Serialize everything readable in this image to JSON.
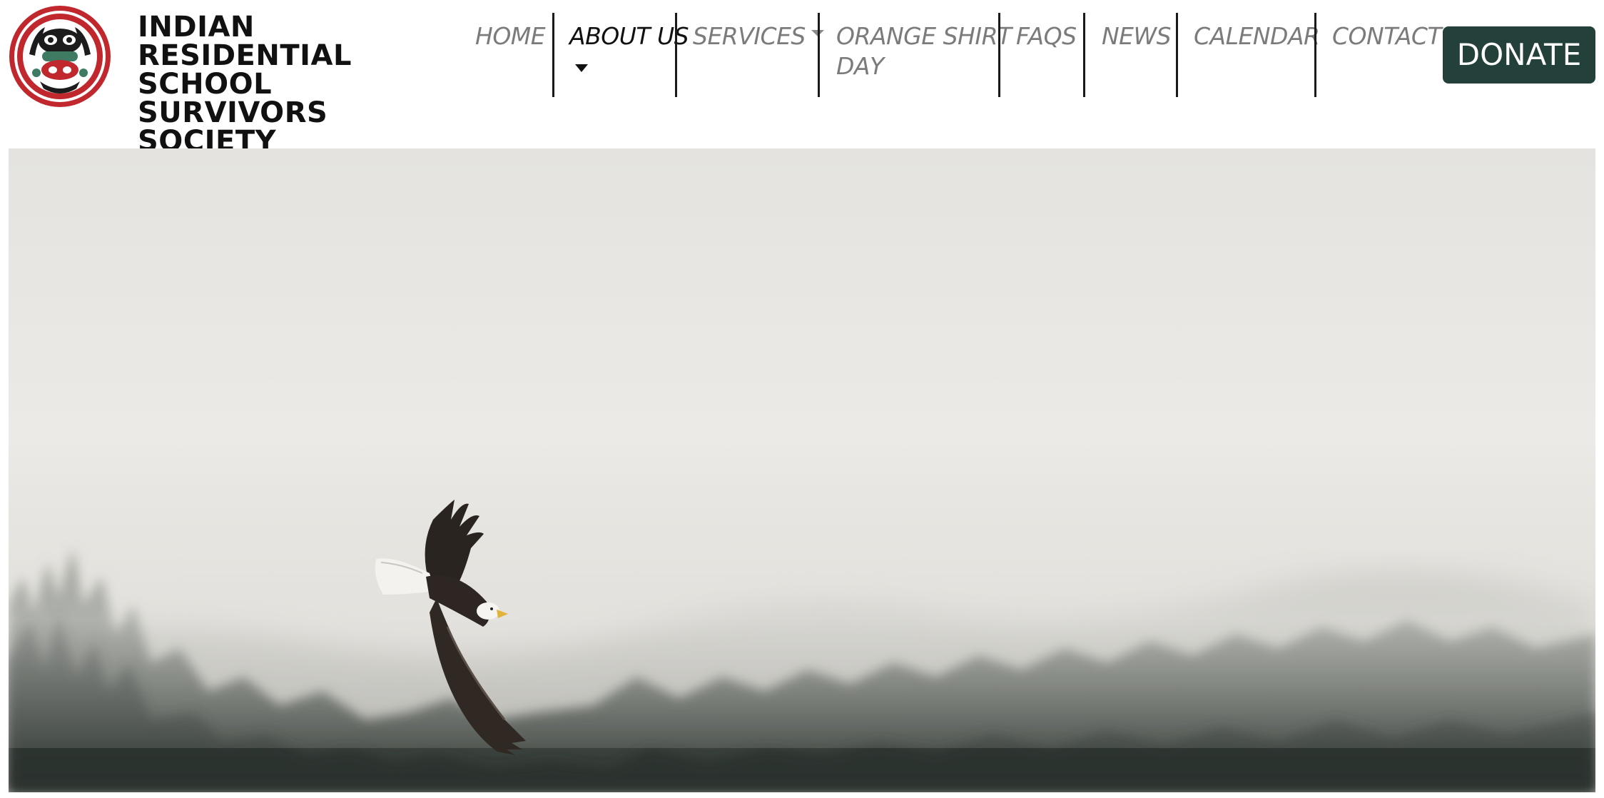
{
  "site": {
    "title_lines": [
      "INDIAN RESIDENTIAL",
      "SCHOOL SURVIVORS",
      "SOCIETY"
    ],
    "logo_icon": "circular-society-crest-logo",
    "colors": {
      "logo_red": "#c0282d",
      "logo_green": "#3f7a62",
      "donate_bg": "#24403a",
      "nav_text": "#7b7b7b",
      "nav_active": "#111111"
    }
  },
  "nav": {
    "home": "HOME",
    "about": "ABOUT US",
    "services": "SERVICES",
    "orange_line1": "ORANGE SHIRT",
    "orange_line2": "DAY",
    "faqs": "FAQS",
    "news": "NEWS",
    "calendar": "CALENDAR",
    "contact": "CONTACT",
    "active_item": "ABOUT US"
  },
  "donate_label": "DONATE",
  "hero": {
    "image_subject": "bald eagle flying over misty forest"
  }
}
